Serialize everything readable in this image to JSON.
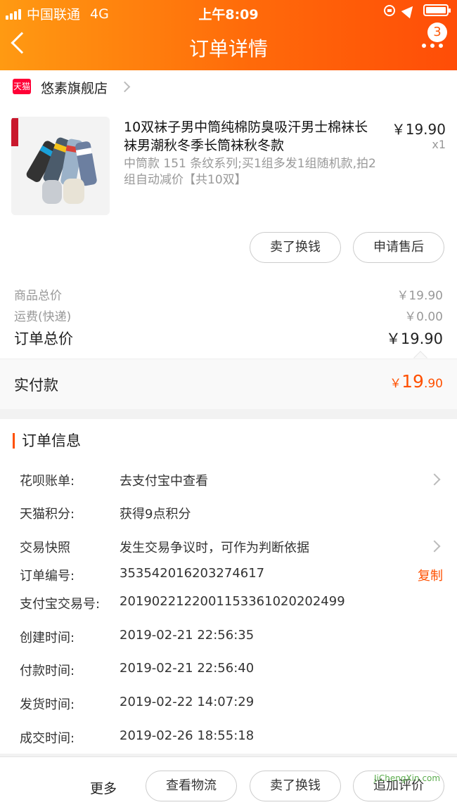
{
  "status": {
    "carrier": "中国联通",
    "network": "4G",
    "time": "上午8:09"
  },
  "nav": {
    "title": "订单详情",
    "badge": "3"
  },
  "shop": {
    "logo_text": "天猫",
    "name": "悠素旗舰店"
  },
  "item": {
    "title": "10双袜子男中筒纯棉防臭吸汗男士棉袜长袜男潮秋冬季长筒袜秋冬款",
    "sku": "中筒款 151 条纹系列;买1组多发1组随机款,拍2组自动减价【共10双】",
    "price": "￥19.90",
    "qty": "x1",
    "buttons": [
      "卖了换钱",
      "申请售后"
    ]
  },
  "price_summary": {
    "goods_total_label": "商品总价",
    "goods_total": "￥19.90",
    "shipping_label": "运费(快递)",
    "shipping": "￥0.00",
    "order_total_label": "订单总价",
    "order_total": "￥19.90"
  },
  "paid": {
    "label": "实付款",
    "currency": "￥",
    "int": "19",
    "dec": ".90"
  },
  "order_info": {
    "title": "订单信息",
    "rows": [
      {
        "k": "花呗账单:",
        "v": "去支付宝中查看"
      },
      {
        "k": "天猫积分:",
        "v": "获得9点积分"
      },
      {
        "k": "交易快照",
        "v": "发生交易争议时，可作为判断依据"
      },
      {
        "k": "订单编号:",
        "v": "353542016203274617"
      },
      {
        "k": "支付宝交易号:",
        "v": "2019022122001153361020202499"
      },
      {
        "k": "创建时间:",
        "v": "2019-02-21 22:56:35"
      },
      {
        "k": "付款时间:",
        "v": "2019-02-21 22:56:40"
      },
      {
        "k": "发货时间:",
        "v": "2019-02-22 14:07:29"
      },
      {
        "k": "成交时间:",
        "v": "2019-02-26 18:55:18"
      }
    ],
    "copy_label": "复制"
  },
  "bottom_bar": {
    "more": "更多",
    "buttons": [
      "查看物流",
      "卖了换钱",
      "追加评价"
    ]
  },
  "watermark": "JiChengXin.com",
  "colors": {
    "accent": "#ff5000",
    "header_start": "#ff9a12",
    "header_end": "#ff4d07"
  }
}
